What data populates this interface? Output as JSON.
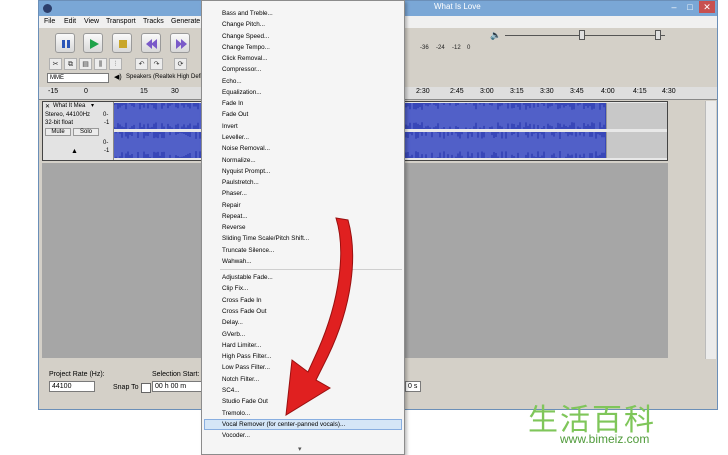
{
  "window": {
    "title": "What Is Love"
  },
  "menubar": [
    "File",
    "Edit",
    "View",
    "Transport",
    "Tracks",
    "Generate"
  ],
  "meter": {
    "ticks": [
      "-36",
      "-24",
      "-12",
      "0"
    ]
  },
  "device": {
    "host": "MME",
    "output": "Speakers (Realtek High Defi"
  },
  "ruler": {
    "ticks_left": [
      "-15",
      "0",
      "15",
      "30"
    ],
    "ticks_right": [
      "2:30",
      "2:45",
      "3:00",
      "3:15",
      "3:30",
      "3:45",
      "4:00",
      "4:15",
      "4:30"
    ]
  },
  "track": {
    "name": "What It Mea",
    "info": [
      "Stereo, 44100Hz",
      "32-bit float"
    ],
    "mute": "Mute",
    "solo": "Solo",
    "scale_ch1": [
      "0-",
      "-1"
    ],
    "scale_ch2": [
      "0-",
      "-1"
    ]
  },
  "selection_bar": {
    "project_rate_label": "Project Rate (Hz):",
    "project_rate": "44100",
    "snap_to": "Snap To",
    "selection_start_label": "Selection Start:",
    "selection_start": "00 h 00 m",
    "end_suffix": "0 s"
  },
  "effect_menu": {
    "group1": [
      "Bass and Treble...",
      "Change Pitch...",
      "Change Speed...",
      "Change Tempo...",
      "Click Removal...",
      "Compressor...",
      "Echo...",
      "Equalization...",
      "Fade In",
      "Fade Out",
      "Invert",
      "Leveller...",
      "Noise Removal...",
      "Normalize...",
      "Nyquist Prompt...",
      "Paulstretch...",
      "Phaser...",
      "Repair",
      "Repeat...",
      "Reverse",
      "Sliding Time Scale/Pitch Shift...",
      "Truncate Silence...",
      "Wahwah..."
    ],
    "group2": [
      "Adjustable Fade...",
      "Clip Fix...",
      "Cross Fade In",
      "Cross Fade Out",
      "Delay...",
      "GVerb...",
      "Hard Limiter...",
      "High Pass Filter...",
      "Low Pass Filter...",
      "Notch Filter...",
      "SC4...",
      "Studio Fade Out",
      "Tremolo...",
      "Vocal Remover (for center-panned vocals)...",
      "Vocoder..."
    ]
  },
  "watermark": {
    "logo": "生活百科",
    "url": "www.bimeiz.com"
  },
  "colors": {
    "waveform": "#3847b8",
    "highlight": "#d5e6f7",
    "arrow": "#e02020",
    "watermark": "#7fc65a"
  }
}
